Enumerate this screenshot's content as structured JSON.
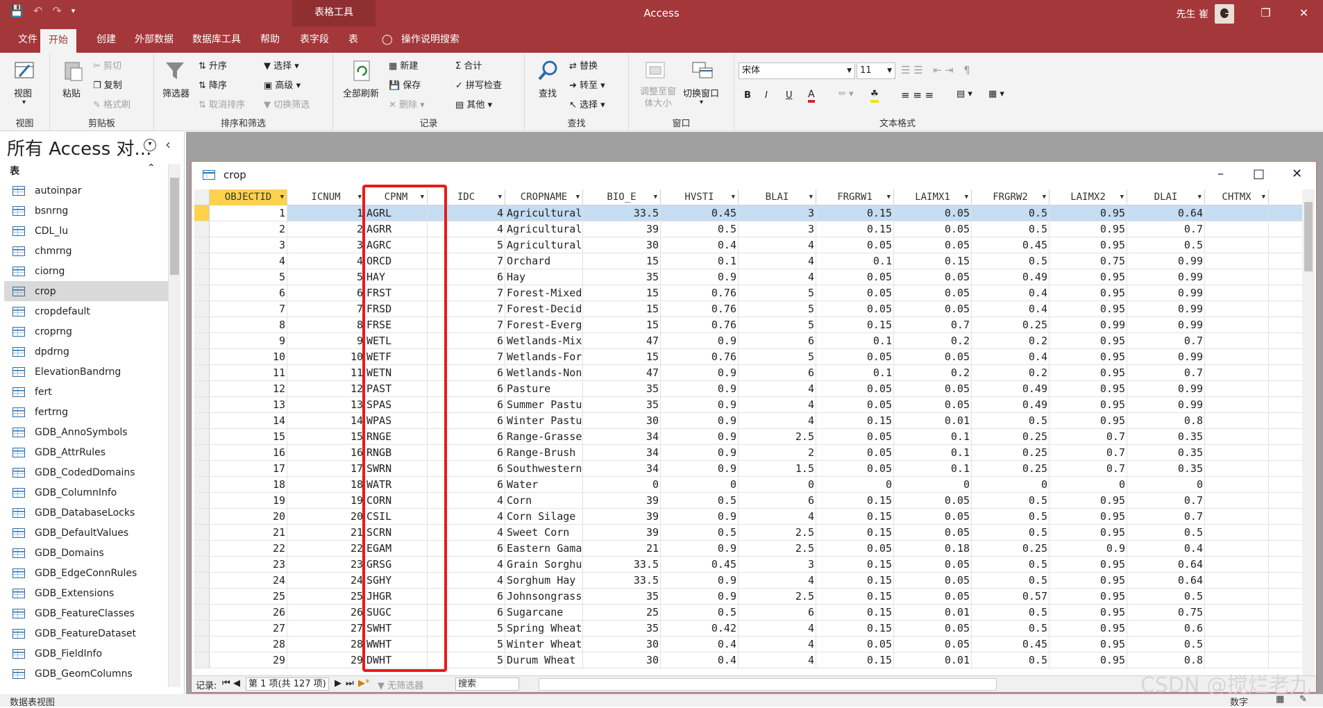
{
  "app": {
    "title": "Access",
    "context_tab": "表格工具",
    "user": "先生 崔"
  },
  "tabs": [
    "文件",
    "开始",
    "创建",
    "外部数据",
    "数据库工具",
    "帮助",
    "表字段",
    "表"
  ],
  "tell_me": "操作说明搜索",
  "ribbon": {
    "view": {
      "label": "视图",
      "group": "视图"
    },
    "clipboard": {
      "paste": "粘贴",
      "cut": "剪切",
      "copy": "复制",
      "format_painter": "格式刷",
      "group": "剪贴板"
    },
    "sort": {
      "filter": "筛选器",
      "asc": "升序",
      "desc": "降序",
      "clear_sort": "取消排序",
      "select": "选择",
      "advanced": "高级",
      "toggle_filter": "切换筛选",
      "group": "排序和筛选"
    },
    "records": {
      "refresh_all": "全部刷新",
      "new": "新建",
      "save": "保存",
      "delete": "删除",
      "totals": "合计",
      "spelling": "拼写检查",
      "more": "其他",
      "group": "记录"
    },
    "find": {
      "find": "查找",
      "replace": "替换",
      "goto": "转至",
      "select": "选择",
      "group": "查找"
    },
    "window": {
      "size_to_fit": "调整至窗体大小",
      "switch": "切换窗口",
      "group": "窗口"
    },
    "text": {
      "font": "宋体",
      "size": "11",
      "group": "文本格式",
      "bold": "B",
      "italic": "I",
      "underline": "U"
    }
  },
  "nav": {
    "title": "所有 Access 对...",
    "section": "表",
    "items": [
      "autoinpar",
      "bsnrng",
      "CDL_lu",
      "chmrng",
      "ciorng",
      "crop",
      "cropdefault",
      "croprng",
      "dpdrng",
      "ElevationBandrng",
      "fert",
      "fertrng",
      "GDB_AnnoSymbols",
      "GDB_AttrRules",
      "GDB_CodedDomains",
      "GDB_ColumnInfo",
      "GDB_DatabaseLocks",
      "GDB_DefaultValues",
      "GDB_Domains",
      "GDB_EdgeConnRules",
      "GDB_Extensions",
      "GDB_FeatureClasses",
      "GDB_FeatureDataset",
      "GDB_FieldInfo",
      "GDB_GeomColumns"
    ],
    "selected": "crop"
  },
  "doc": {
    "title": "crop"
  },
  "table": {
    "columns": [
      "OBJECTID",
      "ICNUM",
      "CPNM",
      "IDC",
      "CROPNAME",
      "BIO_E",
      "HVSTI",
      "BLAI",
      "FRGRW1",
      "LAIMX1",
      "FRGRW2",
      "LAIMX2",
      "DLAI",
      "CHTMX"
    ],
    "rows": [
      [
        "1",
        "1",
        "AGRL",
        "4",
        "Agricultural",
        "33.5",
        "0.45",
        "3",
        "0.15",
        "0.05",
        "0.5",
        "0.95",
        "0.64",
        ""
      ],
      [
        "2",
        "2",
        "AGRR",
        "4",
        "Agricultural",
        "39",
        "0.5",
        "3",
        "0.15",
        "0.05",
        "0.5",
        "0.95",
        "0.7",
        ""
      ],
      [
        "3",
        "3",
        "AGRC",
        "5",
        "Agricultural",
        "30",
        "0.4",
        "4",
        "0.05",
        "0.05",
        "0.45",
        "0.95",
        "0.5",
        ""
      ],
      [
        "4",
        "4",
        "ORCD",
        "7",
        "Orchard",
        "15",
        "0.1",
        "4",
        "0.1",
        "0.15",
        "0.5",
        "0.75",
        "0.99",
        ""
      ],
      [
        "5",
        "5",
        "HAY",
        "6",
        "Hay",
        "35",
        "0.9",
        "4",
        "0.05",
        "0.05",
        "0.49",
        "0.95",
        "0.99",
        ""
      ],
      [
        "6",
        "6",
        "FRST",
        "7",
        "Forest-Mixed",
        "15",
        "0.76",
        "5",
        "0.05",
        "0.05",
        "0.4",
        "0.95",
        "0.99",
        ""
      ],
      [
        "7",
        "7",
        "FRSD",
        "7",
        "Forest-Decid",
        "15",
        "0.76",
        "5",
        "0.05",
        "0.05",
        "0.4",
        "0.95",
        "0.99",
        ""
      ],
      [
        "8",
        "8",
        "FRSE",
        "7",
        "Forest-Everg",
        "15",
        "0.76",
        "5",
        "0.15",
        "0.7",
        "0.25",
        "0.99",
        "0.99",
        ""
      ],
      [
        "9",
        "9",
        "WETL",
        "6",
        "Wetlands-Mix",
        "47",
        "0.9",
        "6",
        "0.1",
        "0.2",
        "0.2",
        "0.95",
        "0.7",
        ""
      ],
      [
        "10",
        "10",
        "WETF",
        "7",
        "Wetlands-For",
        "15",
        "0.76",
        "5",
        "0.05",
        "0.05",
        "0.4",
        "0.95",
        "0.99",
        ""
      ],
      [
        "11",
        "11",
        "WETN",
        "6",
        "Wetlands-Non",
        "47",
        "0.9",
        "6",
        "0.1",
        "0.2",
        "0.2",
        "0.95",
        "0.7",
        ""
      ],
      [
        "12",
        "12",
        "PAST",
        "6",
        "Pasture",
        "35",
        "0.9",
        "4",
        "0.05",
        "0.05",
        "0.49",
        "0.95",
        "0.99",
        ""
      ],
      [
        "13",
        "13",
        "SPAS",
        "6",
        "Summer Pastu",
        "35",
        "0.9",
        "4",
        "0.05",
        "0.05",
        "0.49",
        "0.95",
        "0.99",
        ""
      ],
      [
        "14",
        "14",
        "WPAS",
        "6",
        "Winter Pastu",
        "30",
        "0.9",
        "4",
        "0.15",
        "0.01",
        "0.5",
        "0.95",
        "0.8",
        ""
      ],
      [
        "15",
        "15",
        "RNGE",
        "6",
        "Range-Grasse",
        "34",
        "0.9",
        "2.5",
        "0.05",
        "0.1",
        "0.25",
        "0.7",
        "0.35",
        ""
      ],
      [
        "16",
        "16",
        "RNGB",
        "6",
        "Range-Brush",
        "34",
        "0.9",
        "2",
        "0.05",
        "0.1",
        "0.25",
        "0.7",
        "0.35",
        ""
      ],
      [
        "17",
        "17",
        "SWRN",
        "6",
        "Southwestern",
        "34",
        "0.9",
        "1.5",
        "0.05",
        "0.1",
        "0.25",
        "0.7",
        "0.35",
        ""
      ],
      [
        "18",
        "18",
        "WATR",
        "6",
        "Water",
        "0",
        "0",
        "0",
        "0",
        "0",
        "0",
        "0",
        "0",
        ""
      ],
      [
        "19",
        "19",
        "CORN",
        "4",
        "Corn",
        "39",
        "0.5",
        "6",
        "0.15",
        "0.05",
        "0.5",
        "0.95",
        "0.7",
        ""
      ],
      [
        "20",
        "20",
        "CSIL",
        "4",
        "Corn Silage",
        "39",
        "0.9",
        "4",
        "0.15",
        "0.05",
        "0.5",
        "0.95",
        "0.7",
        ""
      ],
      [
        "21",
        "21",
        "SCRN",
        "4",
        "Sweet Corn",
        "39",
        "0.5",
        "2.5",
        "0.15",
        "0.05",
        "0.5",
        "0.95",
        "0.5",
        ""
      ],
      [
        "22",
        "22",
        "EGAM",
        "6",
        "Eastern Gama",
        "21",
        "0.9",
        "2.5",
        "0.05",
        "0.18",
        "0.25",
        "0.9",
        "0.4",
        ""
      ],
      [
        "23",
        "23",
        "GRSG",
        "4",
        "Grain Sorghu",
        "33.5",
        "0.45",
        "3",
        "0.15",
        "0.05",
        "0.5",
        "0.95",
        "0.64",
        ""
      ],
      [
        "24",
        "24",
        "SGHY",
        "4",
        "Sorghum Hay",
        "33.5",
        "0.9",
        "4",
        "0.15",
        "0.05",
        "0.5",
        "0.95",
        "0.64",
        ""
      ],
      [
        "25",
        "25",
        "JHGR",
        "6",
        "Johnsongrass",
        "35",
        "0.9",
        "2.5",
        "0.15",
        "0.05",
        "0.57",
        "0.95",
        "0.5",
        ""
      ],
      [
        "26",
        "26",
        "SUGC",
        "6",
        "Sugarcane",
        "25",
        "0.5",
        "6",
        "0.15",
        "0.01",
        "0.5",
        "0.95",
        "0.75",
        ""
      ],
      [
        "27",
        "27",
        "SWHT",
        "5",
        "Spring Wheat",
        "35",
        "0.42",
        "4",
        "0.15",
        "0.05",
        "0.5",
        "0.95",
        "0.6",
        ""
      ],
      [
        "28",
        "28",
        "WWHT",
        "5",
        "Winter Wheat",
        "30",
        "0.4",
        "4",
        "0.05",
        "0.05",
        "0.45",
        "0.95",
        "0.5",
        ""
      ],
      [
        "29",
        "29",
        "DWHT",
        "5",
        "Durum Wheat",
        "30",
        "0.4",
        "4",
        "0.15",
        "0.01",
        "0.5",
        "0.95",
        "0.8",
        ""
      ]
    ]
  },
  "record_nav": {
    "label": "记录:",
    "position": "第 1 项(共 127 项)",
    "filter": "无筛选器",
    "search": "搜索"
  },
  "status": {
    "left": "数据表视图",
    "right": "数字"
  },
  "watermark": "CSDN @搅烂老九"
}
